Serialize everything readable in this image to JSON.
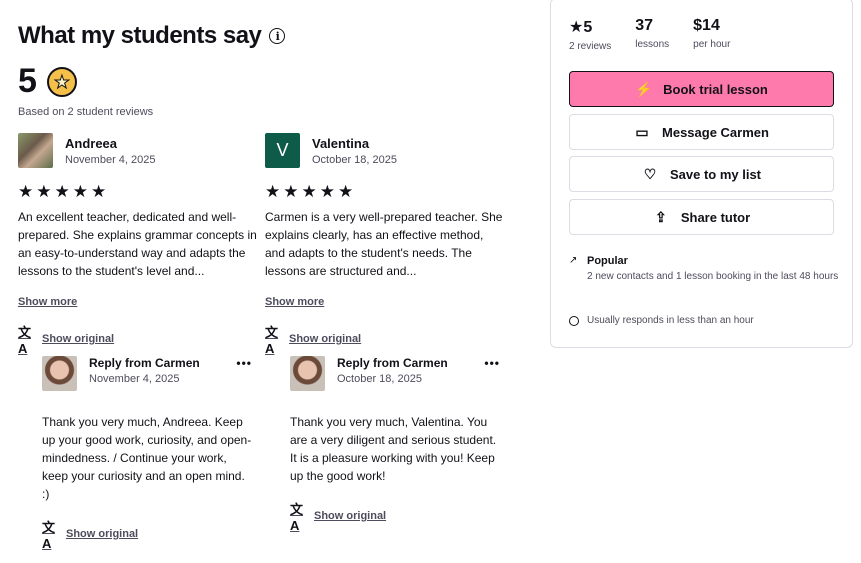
{
  "header": {
    "title": "What my students say"
  },
  "rating": {
    "value": "5",
    "based_on": "Based on 2 student reviews"
  },
  "reviews": [
    {
      "name": "Andreea",
      "date": "November 4, 2025",
      "stars": "★★★★★",
      "text": "An excellent teacher, dedicated and well-prepared. She explains grammar concepts in an easy-to-understand way and adapts the lessons to the student's level and...",
      "show_more": "Show more",
      "show_original": "Show original",
      "reply": {
        "title": "Reply from Carmen",
        "date": "November 4, 2025",
        "text": "Thank you very much, Andreea. Keep up your good work, curiosity, and open-mindedness. / Continue your work, keep your curiosity and an open mind. :)",
        "show_original": "Show original"
      }
    },
    {
      "name": "Valentina",
      "avatar_letter": "V",
      "date": "October 18, 2025",
      "stars": "★★★★★",
      "text": "Carmen is a very well-prepared teacher. She explains clearly, has an effective method, and adapts to the student's needs. The lessons are structured and...",
      "show_more": "Show more",
      "show_original": "Show original",
      "reply": {
        "title": "Reply from Carmen",
        "date": "October 18, 2025",
        "text": "Thank you very much, Valentina. You are a very diligent and serious student. It is a pleasure working with you! Keep up the good work!",
        "show_original": "Show original"
      }
    }
  ],
  "panel": {
    "stats": [
      {
        "value": "★5",
        "label": "2 reviews"
      },
      {
        "value": "37",
        "label": "lessons"
      },
      {
        "value": "$14",
        "label": "per hour"
      }
    ],
    "buttons": {
      "book": "Book trial lesson",
      "message": "Message Carmen",
      "save": "Save to my list",
      "share": "Share tutor"
    },
    "popular_title": "Popular",
    "popular_desc": "2 new contacts and 1 lesson booking in the last 48 hours",
    "responds": "Usually responds in less than an hour"
  },
  "colors": {
    "primary_button": "#ff7aac",
    "avatar_letter_bg": "#0e5b4a"
  }
}
